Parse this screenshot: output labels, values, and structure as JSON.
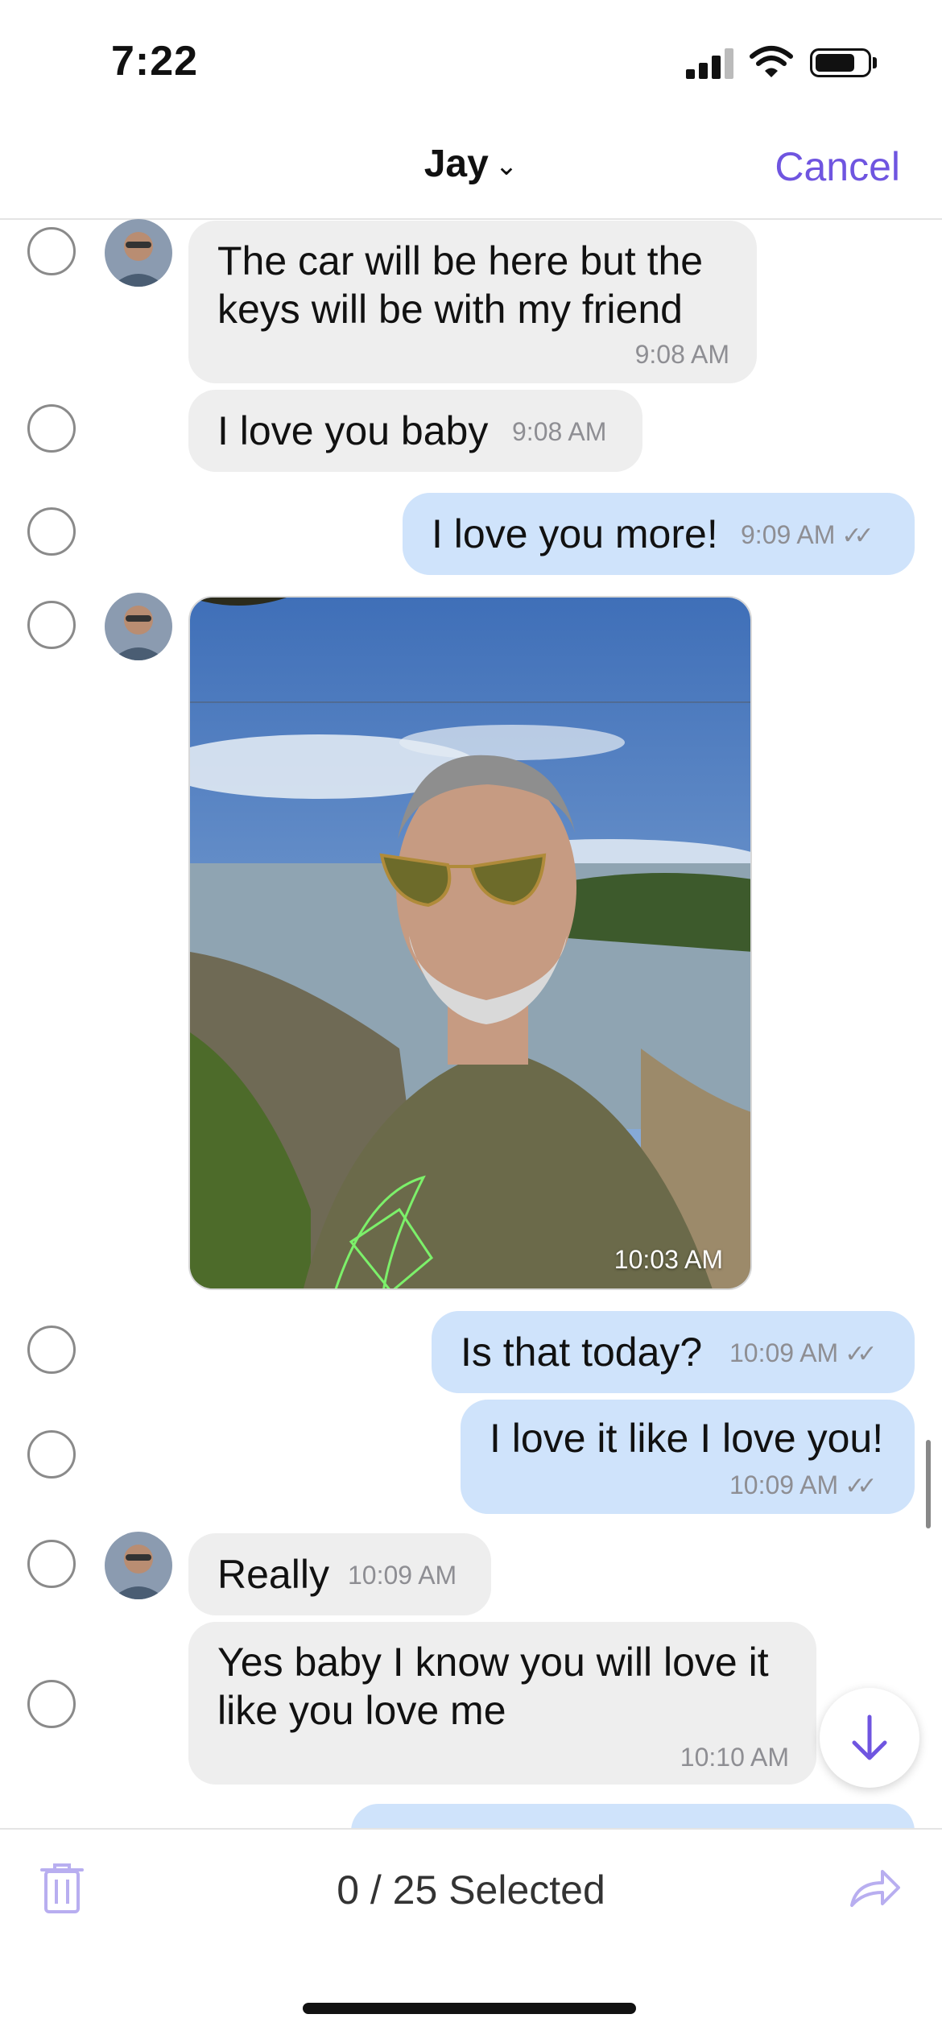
{
  "status_bar": {
    "time": "7:22"
  },
  "header": {
    "title": "Jay",
    "chevron": "⌄",
    "cancel_label": "Cancel"
  },
  "messages": [
    {
      "direction": "incoming",
      "text_line1": "The car will be here but the",
      "text_line2": "keys will be with my friend",
      "time": "9:08 AM"
    },
    {
      "direction": "incoming",
      "text": "I love you baby",
      "time": "9:08 AM"
    },
    {
      "direction": "outgoing",
      "text": "I love you more!",
      "time": "9:09 AM",
      "status_icon": "double-check-icon"
    },
    {
      "direction": "incoming",
      "type": "photo",
      "time": "10:03 AM"
    },
    {
      "direction": "outgoing",
      "text": "Is that today?",
      "time": "10:09 AM",
      "status_icon": "double-check-icon"
    },
    {
      "direction": "outgoing",
      "text": "I love it like I love you!",
      "time": "10:09 AM",
      "status_icon": "double-check-icon"
    },
    {
      "direction": "incoming",
      "text": "Really",
      "time": "10:09 AM"
    },
    {
      "direction": "incoming",
      "text_line1": "Yes baby I know you will love it",
      "text_line2": "like you love me",
      "time": "10:10 AM"
    }
  ],
  "footer": {
    "selected_label": "0 / 25 Selected"
  },
  "icons": {
    "delete": "trash-icon",
    "forward": "forward-icon",
    "scroll_down": "arrow-down-icon",
    "signal": "signal-icon",
    "wifi": "wifi-icon",
    "battery": "battery-icon"
  },
  "colors": {
    "accent": "#6f55e0",
    "incoming_bubble": "#eeeeee",
    "outgoing_bubble": "#cfe3fb"
  }
}
